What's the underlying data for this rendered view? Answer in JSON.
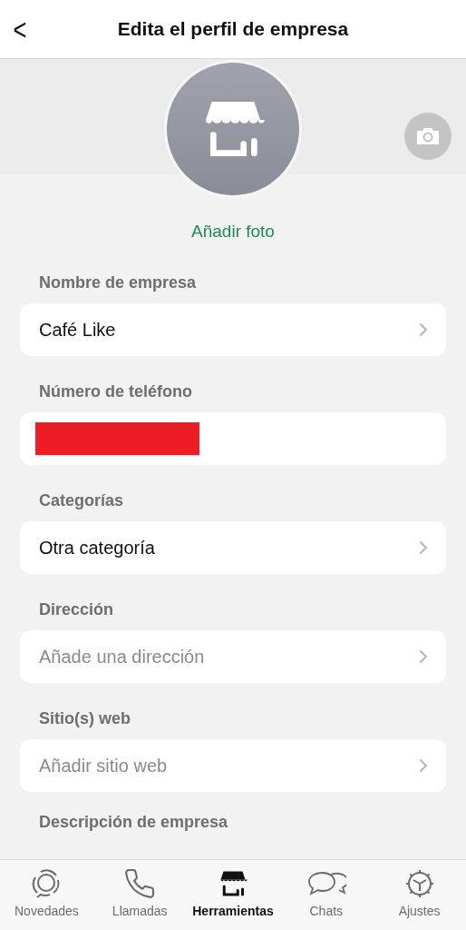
{
  "header": {
    "back": "<",
    "title": "Edita el perfil de empresa"
  },
  "photo": {
    "action": "Añadir foto"
  },
  "fields": [
    {
      "label": "Nombre de empresa",
      "kind": "value",
      "text": "Café Like",
      "chevron": true
    },
    {
      "label": "Número de teléfono",
      "kind": "redacted",
      "chevron": false
    },
    {
      "label": "Categorías",
      "kind": "value",
      "text": "Otra categoría",
      "chevron": true
    },
    {
      "label": "Dirección",
      "kind": "placeholder",
      "text": "Añade una dirección",
      "chevron": true
    },
    {
      "label": "Sitio(s) web",
      "kind": "placeholder",
      "text": "Añadir sitio web",
      "chevron": true
    }
  ],
  "next_section": {
    "label": "Descripción de empresa"
  },
  "tab_bar": [
    {
      "label": "Novedades",
      "kind": "updates",
      "selected": false
    },
    {
      "label": "Llamadas",
      "kind": "calls",
      "selected": false
    },
    {
      "label": "Herramientas",
      "kind": "tools",
      "selected": true
    },
    {
      "label": "Chats",
      "kind": "chats",
      "selected": false
    },
    {
      "label": "Ajustes",
      "kind": "settings",
      "selected": false
    }
  ]
}
